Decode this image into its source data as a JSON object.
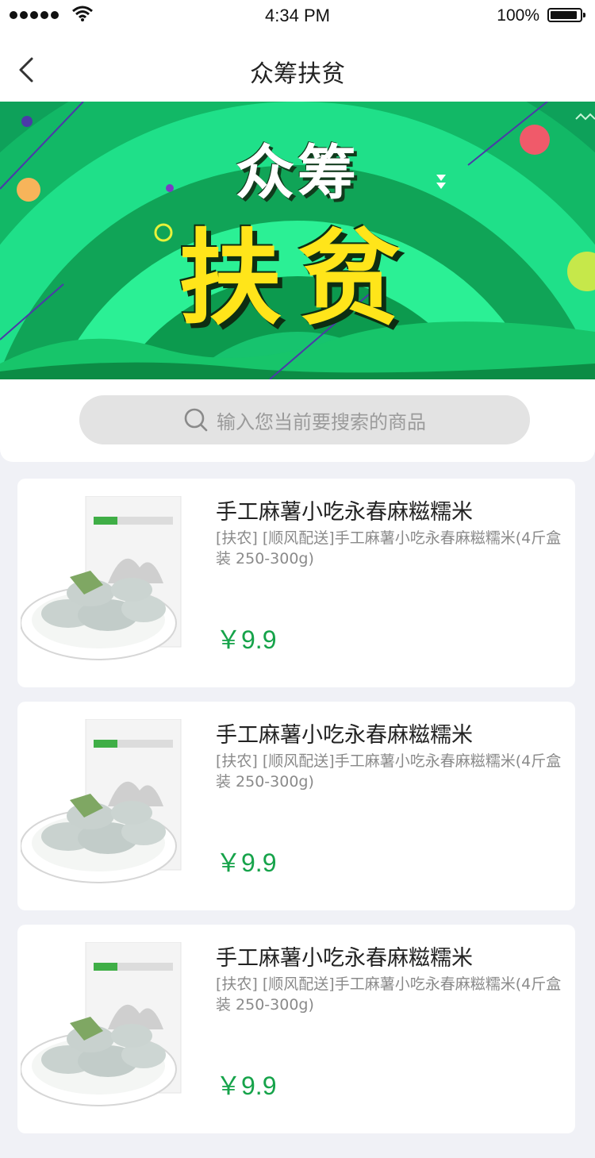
{
  "status_bar": {
    "time": "4:34 PM",
    "battery": "100%"
  },
  "nav": {
    "title": "众筹扶贫",
    "back_icon": "chevron-left-icon"
  },
  "banner": {
    "line1": "众筹",
    "line2": "扶贫",
    "accent_color": "#1fe089",
    "text_color": "#ffe51a"
  },
  "search": {
    "placeholder": "输入您当前要搜索的商品",
    "icon": "search-icon"
  },
  "products": [
    {
      "name": "手工麻薯小吃永春麻糍糯米",
      "desc": "[扶农] [顺风配送]手工麻薯小吃永春麻糍糯米(4斤盒装 250-300g)",
      "price": "￥9.9"
    },
    {
      "name": "手工麻薯小吃永春麻糍糯米",
      "desc": "[扶农] [顺风配送]手工麻薯小吃永春麻糍糯米(4斤盒装 250-300g)",
      "price": "￥9.9"
    },
    {
      "name": "手工麻薯小吃永春麻糍糯米",
      "desc": "[扶农] [顺风配送]手工麻薯小吃永春麻糍糯米(4斤盒装 250-300g)",
      "price": "￥9.9"
    }
  ],
  "colors": {
    "price": "#16a34a",
    "page_bg": "#f0f1f6",
    "search_bg": "#e3e3e3"
  }
}
